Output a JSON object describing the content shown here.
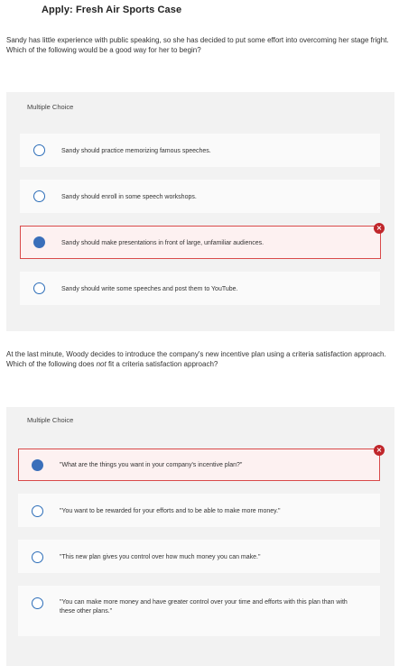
{
  "page_title": "Apply: Fresh Air Sports Case",
  "question1": {
    "prompt_line1": "Sandy has little experience with public speaking, so she has decided to put some effort into overcoming her stage fright.",
    "prompt_line2": "Which of the following would be a good way for her to begin?",
    "type_label": "Multiple Choice",
    "options": [
      {
        "text": "Sandy should practice memorizing famous speeches.",
        "selected": false
      },
      {
        "text": "Sandy should enroll in some speech workshops.",
        "selected": false
      },
      {
        "text": "Sandy should make presentations in front of large, unfamiliar audiences.",
        "selected": true,
        "status": "incorrect"
      },
      {
        "text": "Sandy should write some speeches and post them to YouTube.",
        "selected": false
      }
    ]
  },
  "question2": {
    "prompt_line1": "At the last minute, Woody decides to introduce the company's new incentive plan using a criteria satisfaction approach.",
    "prompt_line2_before": "Which of the following does ",
    "prompt_line2_emph": "not",
    "prompt_line2_after": " fit a criteria satisfaction approach?",
    "type_label": "Multiple Choice",
    "options": [
      {
        "text": "\"What are the things you want in your company's incentive plan?\"",
        "selected": true,
        "status": "incorrect"
      },
      {
        "text": "\"You want to be rewarded for your efforts and to be able to make more money.\"",
        "selected": false
      },
      {
        "text": "\"This new plan gives you control over how much money you can make.\"",
        "selected": false
      },
      {
        "text_line1": "\"You can make more money and have greater control over your time and efforts with this plan than with",
        "text_line2": "these other plans.\"",
        "selected": false
      }
    ]
  },
  "icons": {
    "incorrect_mark": "×"
  },
  "colors": {
    "radio_blue": "#3a6fba",
    "error_red": "#d94a4a",
    "badge_red": "#c0262b"
  }
}
